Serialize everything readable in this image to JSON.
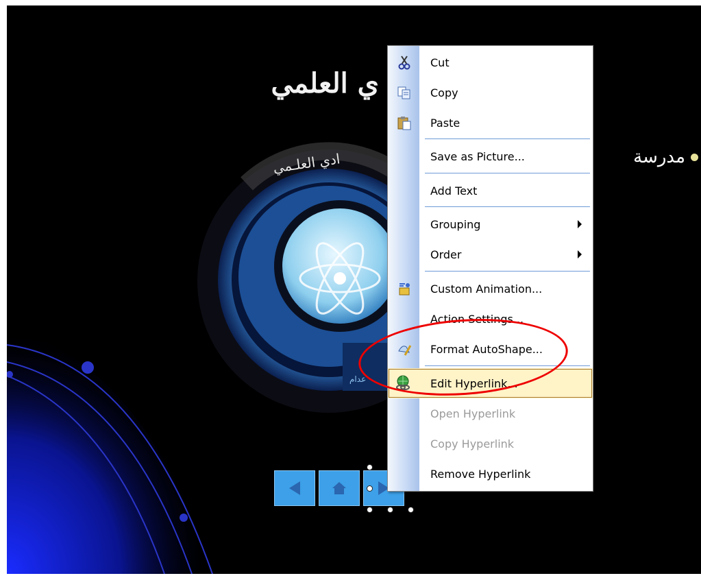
{
  "slide": {
    "title": "ي العلمي",
    "bullet_text": "مدرسة",
    "logo_arc_text": "ادي العلـمي",
    "logo_caption": "عدام"
  },
  "nav_buttons": [
    {
      "name": "back-arrow-icon"
    },
    {
      "name": "home-icon"
    },
    {
      "name": "forward-arrow-icon"
    }
  ],
  "context_menu": {
    "items": [
      {
        "label": "Cut",
        "icon": "scissors-icon",
        "enabled": true
      },
      {
        "label": "Copy",
        "icon": "copy-icon",
        "enabled": true
      },
      {
        "label": "Paste",
        "icon": "paste-icon",
        "enabled": true
      },
      {
        "label": "Save as Picture...",
        "icon": "",
        "enabled": true
      },
      {
        "label": "Add Text",
        "icon": "",
        "enabled": true
      },
      {
        "label": "Grouping",
        "icon": "",
        "enabled": true,
        "submenu": true
      },
      {
        "label": "Order",
        "icon": "",
        "enabled": true,
        "submenu": true
      },
      {
        "label": "Custom Animation...",
        "icon": "custom-animation-icon",
        "enabled": true
      },
      {
        "label": "Action Settings...",
        "icon": "",
        "enabled": true
      },
      {
        "label": "Format AutoShape...",
        "icon": "format-autoshape-icon",
        "enabled": true
      },
      {
        "label": "Edit Hyperlink...",
        "icon": "hyperlink-globe-icon",
        "enabled": true,
        "highlighted": true
      },
      {
        "label": "Open Hyperlink",
        "icon": "",
        "enabled": false
      },
      {
        "label": "Copy Hyperlink",
        "icon": "",
        "enabled": false
      },
      {
        "label": "Remove Hyperlink",
        "icon": "",
        "enabled": true
      }
    ]
  },
  "colors": {
    "slide_background": "#000000",
    "nav_button": "#3da0e8",
    "menu_highlight": "#fff3c8",
    "annotation_circle": "#ee0000"
  }
}
